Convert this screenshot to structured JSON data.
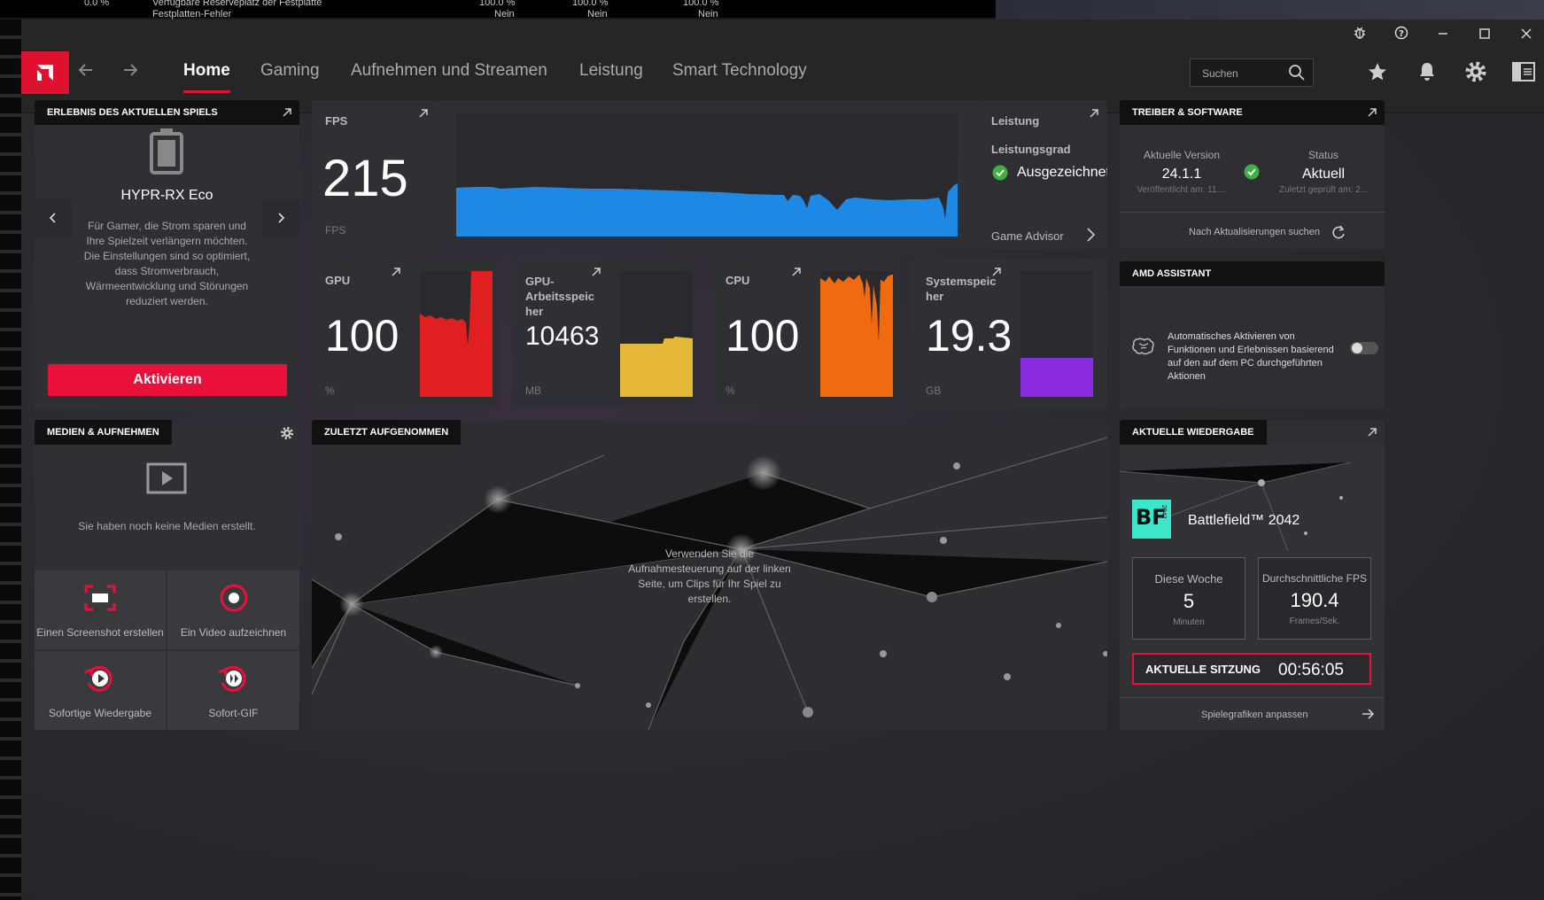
{
  "background": {
    "row1": {
      "c1": "0.0 %",
      "c2": "Verfügbare Reserveplatz der Festplatte",
      "c3": "100.0 %",
      "c4": "100.0 %",
      "c5": "100.0 %"
    },
    "row2": {
      "c2": "Festplatten-Fehler",
      "c3": "Nein",
      "c4": "Nein",
      "c5": "Nein"
    }
  },
  "nav": {
    "items": [
      "Home",
      "Gaming",
      "Aufnehmen und Streamen",
      "Leistung",
      "Smart Technology"
    ],
    "search_placeholder": "Suchen",
    "accent": "#e0102f"
  },
  "game_experience": {
    "header": "ERLEBNIS DES AKTUELLEN SPIELS",
    "profile_name": "HYPR-RX Eco",
    "description": "Für Gamer, die Strom sparen und Ihre Spielzeit verlängern möchten. Die Einstellungen sind so optimiert, dass Stromverbrauch, Wärmeentwicklung und Störungen reduziert werden.",
    "activate_label": "Aktivieren"
  },
  "fps": {
    "label": "FPS",
    "value": "215",
    "unit": "FPS",
    "color": "#1e88e5"
  },
  "performance": {
    "title": "Leistung",
    "grade_label": "Leistungsgrad",
    "grade_value": "Ausgezeichnet",
    "advisor_label": "Game Advisor"
  },
  "metrics": [
    {
      "label": "GPU",
      "value": "100",
      "unit": "%",
      "color": "#e02020"
    },
    {
      "label": "GPU-\nArbeitsspeic\nher",
      "value": "10463",
      "unit": "MB",
      "color": "#e6b83a"
    },
    {
      "label": "CPU",
      "value": "100",
      "unit": "%",
      "color": "#f06a10"
    },
    {
      "label": "Systemspeic\nher",
      "value": "19.3",
      "unit": "GB",
      "color": "#8a2be2"
    }
  ],
  "driver": {
    "header": "TREIBER & SOFTWARE",
    "version_label": "Aktuelle Version",
    "version_value": "24.1.1",
    "released": "Veröffentlicht am: 11....",
    "status_label": "Status",
    "status_value": "Aktuell",
    "checked": "Zuletzt geprüft am: 2...",
    "update_label": "Nach Aktualisierungen suchen"
  },
  "assistant": {
    "header": "AMD ASSISTANT",
    "text": "Automatisches Aktivieren von Funktionen und Erlebnissen basierend auf den auf dem PC durchgeführten Aktionen",
    "toggle_on": false
  },
  "media": {
    "header": "MEDIEN & AUFNEHMEN",
    "empty_text": "Sie haben noch keine Medien erstellt.",
    "actions": [
      "Einen Screenshot erstellen",
      "Ein Video aufzeichnen",
      "Sofortige Wiedergabe",
      "Sofort-GIF"
    ]
  },
  "recent": {
    "header": "ZULETZT AUFGENOMMEN",
    "text": "Verwenden Sie die Aufnahmesteuerung auf der linken Seite, um Clips für Ihr Spiel zu erstellen."
  },
  "playback": {
    "header": "AKTUELLE WIEDERGABE",
    "game": "Battlefield™ 2042",
    "logo_text": "BF",
    "logo_sub": "2042",
    "week_label": "Diese Woche",
    "week_value": "5",
    "week_unit": "Minuten",
    "avg_label": "Durchschnittliche FPS",
    "avg_value": "190.4",
    "avg_unit": "Frames/Sek.",
    "session_label": "AKTUELLE SITZUNG",
    "session_value": "00:56:05",
    "adjust_label": "Spielegrafiken anpassen"
  }
}
